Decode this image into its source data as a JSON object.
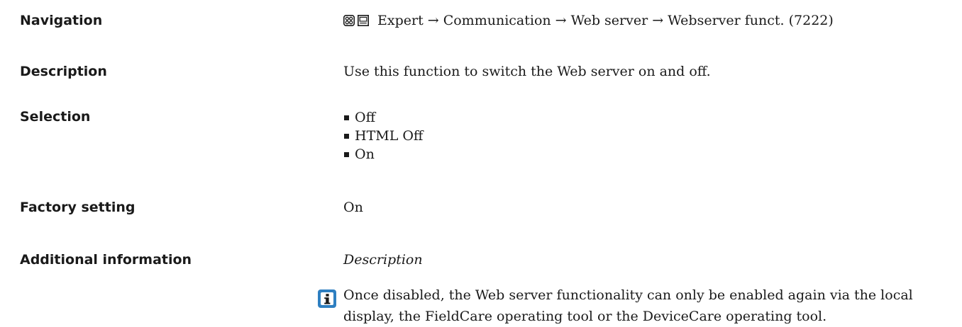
{
  "navigation": {
    "label": "Navigation",
    "icons": [
      "display-operation-icon",
      "operating-tool-icon"
    ],
    "path": "Expert → Communication → Web server → Webserver funct. (7222)"
  },
  "description": {
    "label": "Description",
    "text": "Use this function to switch the Web server on and off."
  },
  "selection": {
    "label": "Selection",
    "options": [
      "Off",
      "HTML Off",
      "On"
    ]
  },
  "factory_setting": {
    "label": "Factory setting",
    "value": "On"
  },
  "additional_information": {
    "label": "Additional information",
    "subheading": "Description",
    "note_icon": "information-icon",
    "note_color": "#2e7fc1",
    "note_text": "Once disabled, the Web server functionality can only be enabled again via the local display, the FieldCare operating tool or the DeviceCare operating tool."
  }
}
